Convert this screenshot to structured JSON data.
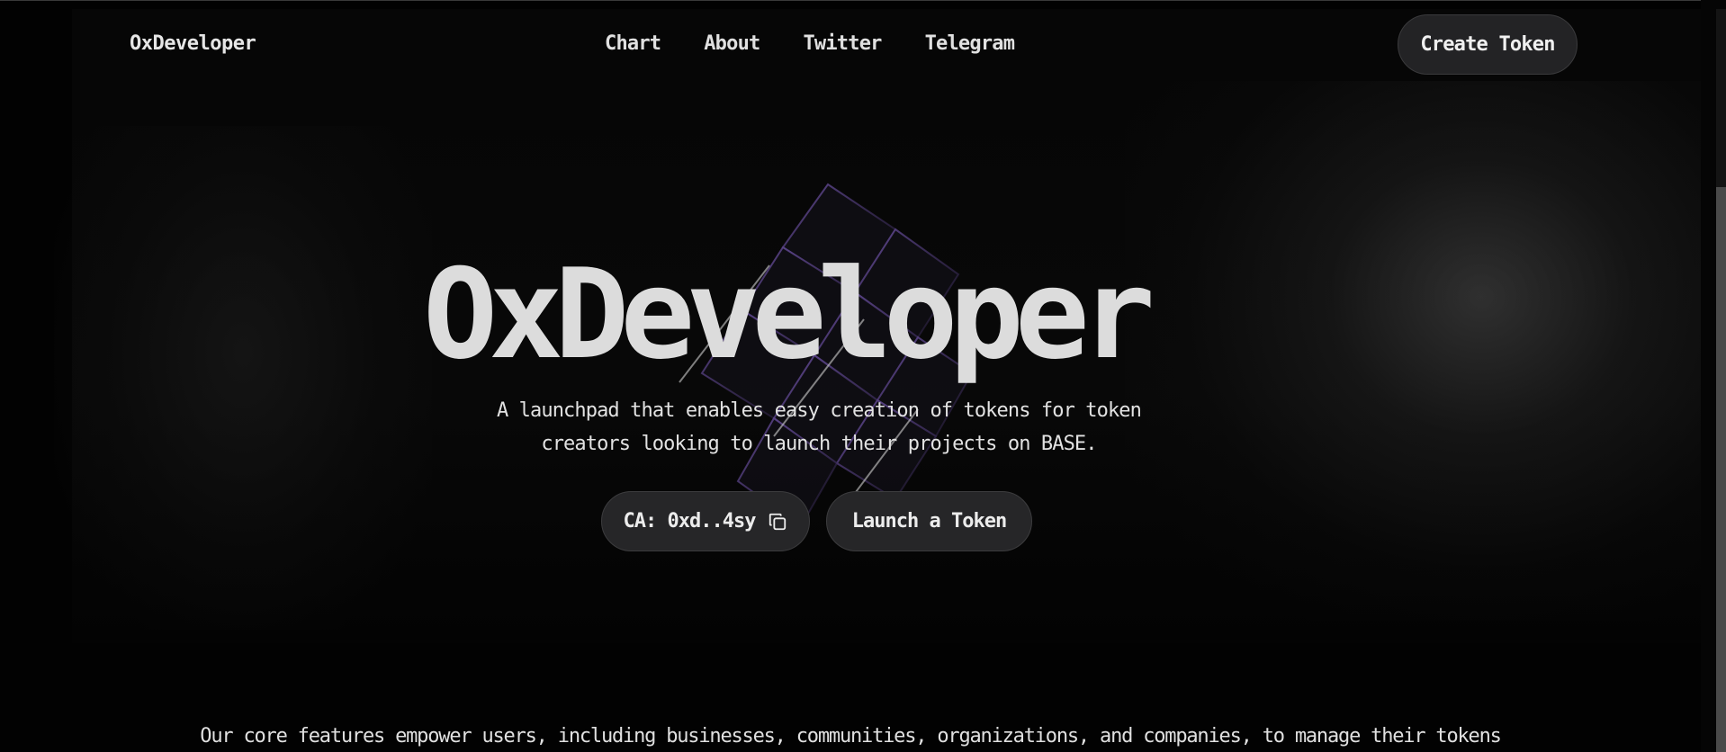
{
  "header": {
    "brand": "OxDeveloper",
    "nav": [
      "Chart",
      "About",
      "Twitter",
      "Telegram"
    ],
    "create_label": "Create Token"
  },
  "hero": {
    "title": "OxDeveloper",
    "subtitle_line1": "A launchpad that enables easy creation of tokens for token",
    "subtitle_line2": "creators looking to launch their projects on BASE.",
    "ca_label": "CA: 0xd..4sy",
    "launch_label": "Launch a Token"
  },
  "features": {
    "text": "Our core features empower users, including businesses, communities, organizations, and companies, to manage their tokens"
  },
  "icons": {
    "copy": "copy-icon"
  }
}
